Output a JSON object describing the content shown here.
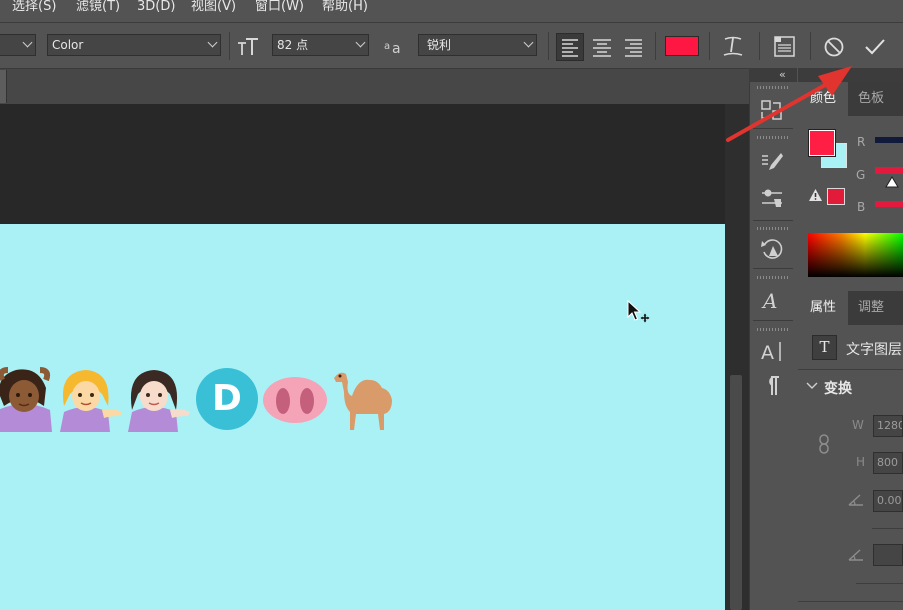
{
  "menu": [
    {
      "id": "select",
      "label": "选择(S)"
    },
    {
      "id": "filter",
      "label": "滤镜(T)"
    },
    {
      "id": "3d",
      "label": "3D(D)"
    },
    {
      "id": "view",
      "label": "视图(V)"
    },
    {
      "id": "window",
      "label": "窗口(W)"
    },
    {
      "id": "help",
      "label": "帮助(H)"
    }
  ],
  "options": {
    "font_style": "Color",
    "font_size": "82 点",
    "antialias": "锐利",
    "text_color": "#ff1744"
  },
  "panels": {
    "collapse_glyph": "«",
    "color_tabs": [
      "颜色",
      "色板"
    ],
    "channels": [
      "R",
      "G",
      "B"
    ],
    "fg_color": "#ff1f44",
    "bg_color": "#aaf1f6",
    "warn_color": "#e31b3a",
    "props_tabs": [
      "属性",
      "调整"
    ],
    "layer_type": "文字图层",
    "layer_type_icon": "T",
    "transform_title": "变换",
    "w_label": "W",
    "h_label": "H",
    "w_value": "1280",
    "h_value": "800",
    "angle_value": "0.00"
  },
  "canvas": {
    "background": "#aaf1f6",
    "emojis": [
      "woman-gesturing-ok-emoji",
      "woman-tipping-hand-emoji",
      "woman-tipping-hand-light-emoji",
      "letter-d-emoji",
      "pig-nose-emoji",
      "camel-emoji"
    ],
    "d_letter": "D"
  },
  "icons": {
    "commit": "check-icon",
    "cancel": "cancel-icon",
    "toggle_panels": "character-panels-icon",
    "warp": "warp-text-icon"
  }
}
